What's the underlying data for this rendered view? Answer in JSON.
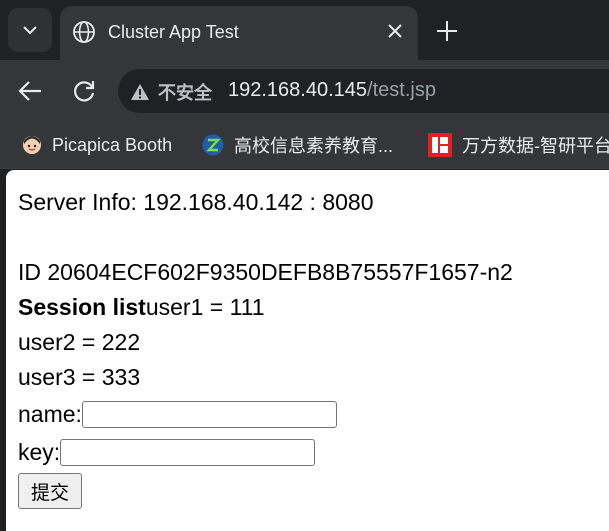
{
  "tab": {
    "title": "Cluster App Test",
    "search_icon": "chevron-down-icon",
    "favicon": "globe-icon",
    "close_icon": "close-icon",
    "new_tab_icon": "plus-icon"
  },
  "toolbar": {
    "back_icon": "arrow-left-icon",
    "reload_icon": "reload-icon",
    "security_warning_icon": "warning-triangle-icon",
    "security_label": "不安全",
    "url_host": "192.168.40.145",
    "url_path": "/test.jsp"
  },
  "bookmarks": [
    {
      "label": "Picapica Booth",
      "icon": "avatar-icon"
    },
    {
      "label": "高校信息素养教育...",
      "icon": "z-logo-icon"
    },
    {
      "label": "万方数据-智研平台",
      "icon": "wanfang-logo-icon"
    }
  ],
  "page": {
    "server_info": "Server Info: 192.168.40.142 : 8080",
    "session_id": "ID 20604ECF602F9350DEFB8B75557F1657-n2",
    "session_list_label": "Session list",
    "session_items": [
      "user1 = 111",
      "user2 = 222",
      "user3 = 333"
    ],
    "form": {
      "name_label": "name:",
      "name_value": "",
      "key_label": "key:",
      "key_value": "",
      "submit_label": "提交"
    }
  },
  "colors": {
    "chrome_dark": "#202124",
    "toolbar": "#35363a",
    "text_light": "#e8eaed",
    "page_bg": "#ffffff"
  }
}
